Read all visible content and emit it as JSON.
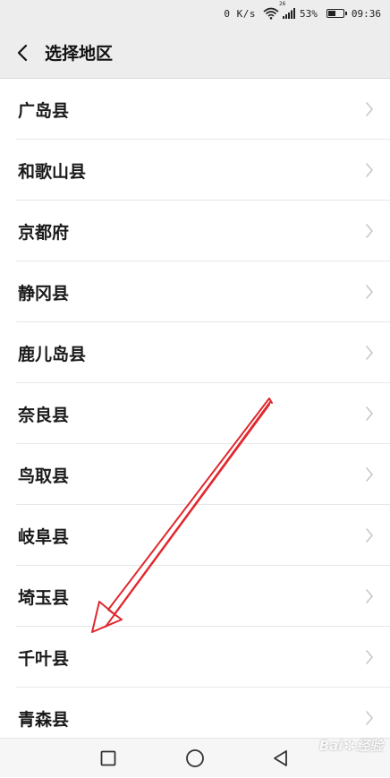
{
  "status_bar": {
    "speed": "0 K/s",
    "signal_badge": "26",
    "battery_pct": "53%",
    "battery_level": 0.53,
    "time": "09:36"
  },
  "header": {
    "title": "选择地区"
  },
  "regions": [
    {
      "label": "广岛县"
    },
    {
      "label": "和歌山县"
    },
    {
      "label": "京都府"
    },
    {
      "label": "静冈县"
    },
    {
      "label": "鹿儿岛县"
    },
    {
      "label": "奈良县"
    },
    {
      "label": "鸟取县"
    },
    {
      "label": "岐阜县"
    },
    {
      "label": "埼玉县"
    },
    {
      "label": "千叶县"
    },
    {
      "label": "青森县"
    }
  ],
  "watermark": {
    "text_left": "Bai",
    "text_right": "经验"
  },
  "colors": {
    "header_bg": "#ededed",
    "divider": "#e8e8e8",
    "arrow": "#e0282e"
  }
}
